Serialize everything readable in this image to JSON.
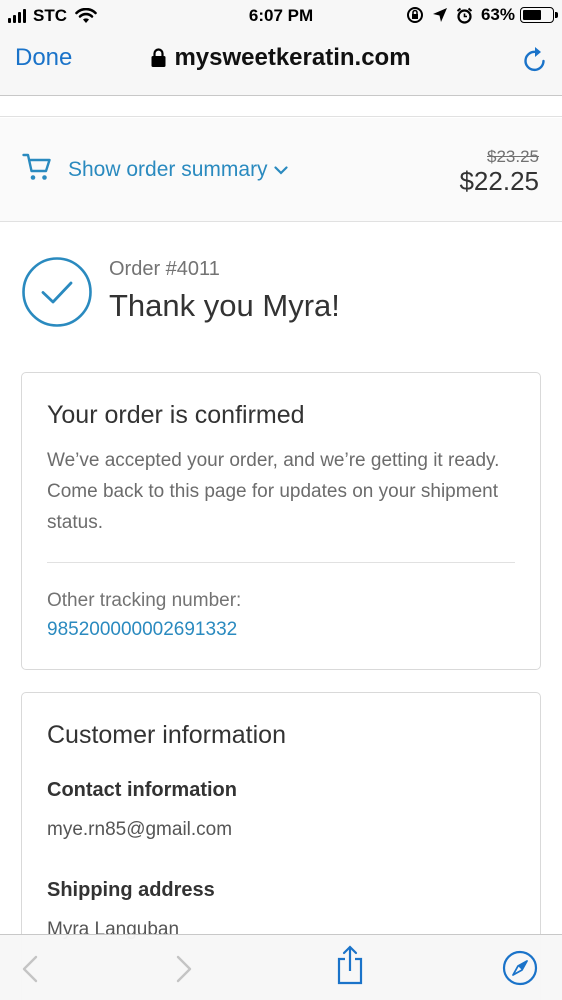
{
  "status_bar": {
    "carrier": "STC",
    "time": "6:07 PM",
    "battery_percent": "63%",
    "battery_level": 0.63,
    "icons": [
      "signal-icon",
      "wifi-icon",
      "orientation-lock-icon",
      "location-icon",
      "alarm-icon",
      "battery-icon"
    ]
  },
  "browser": {
    "done_label": "Done",
    "url": "mysweetkeratin.com",
    "icons": [
      "lock-icon",
      "reload-icon"
    ]
  },
  "order_summary": {
    "toggle_label": "Show order summary",
    "original_price": "$23.25",
    "total_price": "$22.25",
    "icons": [
      "cart-icon",
      "chevron-down-icon"
    ]
  },
  "heading": {
    "order_number": "Order #4011",
    "title": "Thank you Myra!",
    "icons": [
      "checkmark-circle-icon"
    ]
  },
  "confirmation": {
    "title": "Your order is confirmed",
    "body": "We’ve accepted your order, and we’re getting it ready. Come back to this page for updates on your shipment status.",
    "tracking_label": "Other tracking number:",
    "tracking_number": "985200000002691332"
  },
  "customer": {
    "title": "Customer information",
    "contact_heading": "Contact information",
    "email": "mye.rn85@gmail.com",
    "shipping_heading": "Shipping address",
    "shipping_name": "Myra Languban"
  },
  "toolbar": {
    "icons": [
      "back-icon",
      "forward-icon",
      "share-icon",
      "safari-compass-icon"
    ]
  },
  "colors": {
    "link_blue": "#2a8abf",
    "ios_blue": "#1a73c9",
    "text_dark": "#333333",
    "text_muted": "#737373"
  }
}
